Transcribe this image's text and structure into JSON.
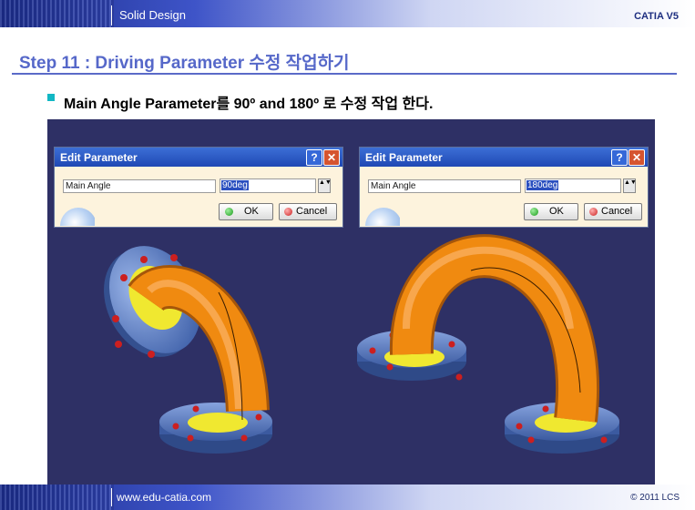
{
  "header": {
    "course": "Solid Design",
    "brand": "CATIA V5"
  },
  "slide": {
    "title": "Step 11 : Driving Parameter 수정 작업하기",
    "bullet": "Main Angle Parameter를 90º and 180º 로 수정 작업 한다."
  },
  "dialogs": [
    {
      "title": "Edit Parameter",
      "help": "?",
      "close": "✕",
      "param_name": "Main Angle",
      "value": "90deg",
      "spinner": "▲▼",
      "ok": "OK",
      "cancel": "Cancel"
    },
    {
      "title": "Edit Parameter",
      "help": "?",
      "close": "✕",
      "param_name": "Main Angle",
      "value": "180deg",
      "spinner": "▲▼",
      "ok": "OK",
      "cancel": "Cancel"
    }
  ],
  "colors": {
    "pipe": "#f08a10",
    "flange": "#5b7fc4",
    "gasket": "#f0e830",
    "viewport_bg": "#2e3065",
    "title": "#5668c9"
  },
  "footer": {
    "site": "www.edu-catia.com",
    "copyright": "© 2011 LCS"
  }
}
